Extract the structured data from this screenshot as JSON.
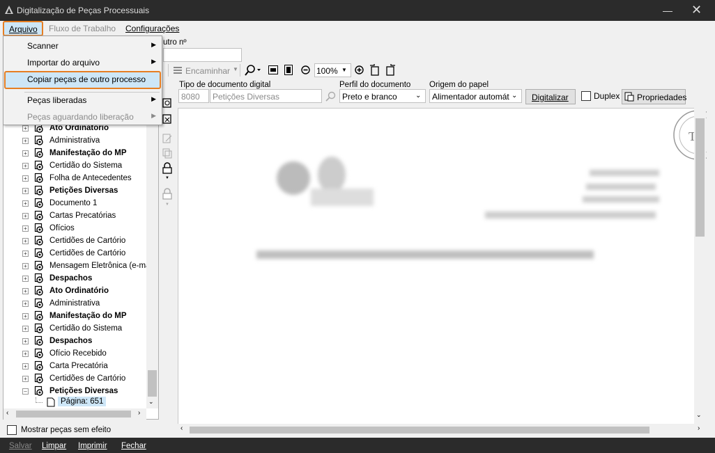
{
  "window": {
    "title": "Digitalização de Peças Processuais"
  },
  "menubar": {
    "arquivo": "Arquivo",
    "fluxo": "Fluxo de Trabalho",
    "configuracoes": "Configurações"
  },
  "dropdown": {
    "items": [
      {
        "label": "Scanner",
        "submenu": true,
        "enabled": true
      },
      {
        "label": "Importar do arquivo",
        "submenu": true,
        "enabled": true
      },
      {
        "label": "Copiar peças de outro processo",
        "submenu": false,
        "enabled": true,
        "highlighted": true
      },
      {
        "label": "Peças liberadas",
        "submenu": true,
        "enabled": true
      },
      {
        "label": "Peças aguardando liberação",
        "submenu": true,
        "enabled": false
      }
    ]
  },
  "header": {
    "outro_label": "utro nº"
  },
  "toolbar": {
    "encaminhar": "Encaminhar",
    "zoom": "100%"
  },
  "form": {
    "tipo_label": "Tipo de documento digital",
    "tipo_code": "8080",
    "tipo_value": "Petições Diversas",
    "perfil_label": "Perfil do documento",
    "perfil_value": "Preto e branco",
    "origem_label": "Origem do papel",
    "origem_value": "Alimentador automát",
    "digitalizar": "Digitalizar",
    "duplex": "Duplex",
    "propriedades": "Propriedades"
  },
  "tree": [
    {
      "label": "Ato Ordinatório",
      "bold": true
    },
    {
      "label": "Administrativa",
      "bold": false
    },
    {
      "label": "Manifestação do MP",
      "bold": true
    },
    {
      "label": "Certidão do Sistema",
      "bold": false
    },
    {
      "label": "Folha de Antecedentes",
      "bold": false
    },
    {
      "label": "Petições Diversas",
      "bold": true
    },
    {
      "label": "Documento 1",
      "bold": false
    },
    {
      "label": "Cartas Precatórias",
      "bold": false
    },
    {
      "label": "Ofícios",
      "bold": false
    },
    {
      "label": "Certidões de Cartório",
      "bold": false
    },
    {
      "label": "Certidões de Cartório",
      "bold": false
    },
    {
      "label": "Mensagem Eletrônica (e-ma",
      "bold": false
    },
    {
      "label": "Despachos",
      "bold": true
    },
    {
      "label": "Ato Ordinatório",
      "bold": true
    },
    {
      "label": "Administrativa",
      "bold": false
    },
    {
      "label": "Manifestação do MP",
      "bold": true
    },
    {
      "label": "Certidão do Sistema",
      "bold": false
    },
    {
      "label": "Despachos",
      "bold": true
    },
    {
      "label": "Ofício Recebido",
      "bold": false
    },
    {
      "label": "Carta Precatória",
      "bold": false
    },
    {
      "label": "Certidões de Cartório",
      "bold": false
    },
    {
      "label": "Petições Diversas",
      "bold": true
    }
  ],
  "tree_page": "Página: 651",
  "mostrar": "Mostrar peças sem efeito",
  "bottom": {
    "salvar": "Salvar",
    "limpar": "Limpar",
    "imprimir": "Imprimir",
    "fechar": "Fechar"
  }
}
